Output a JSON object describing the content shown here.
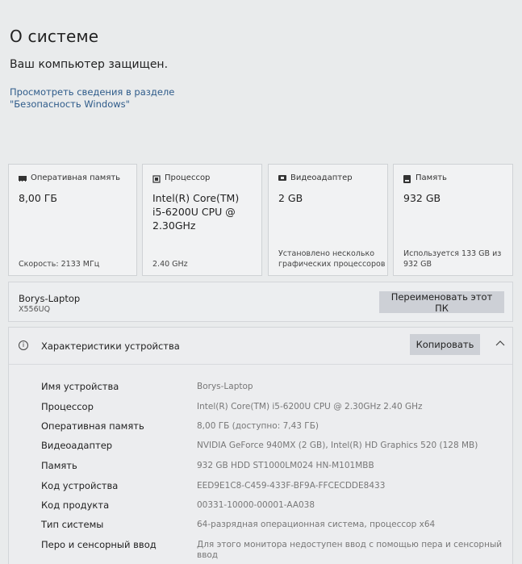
{
  "header": {
    "title": "О системе",
    "protected_text": "Ваш компьютер защищен.",
    "security_link": "Просмотреть сведения в разделе \"Безопасность Windows\""
  },
  "cards": [
    {
      "label": "Оперативная память",
      "icon": "ram-icon",
      "value": "8,00 ГБ",
      "foot": "Скорость: 2133 МГц"
    },
    {
      "label": "Процессор",
      "icon": "processor-icon",
      "value": "Intel(R) Core(TM) i5-6200U CPU @ 2.30GHz",
      "foot": "2.40 GHz"
    },
    {
      "label": "Видеоадаптер",
      "icon": "gpu-icon",
      "value": "2 GB",
      "foot": "Установлено несколько графических процессоров"
    },
    {
      "label": "Память",
      "icon": "storage-icon",
      "value": "932 GB",
      "foot": "Используется 133 GB из 932 GB"
    }
  ],
  "pc": {
    "name": "Borys-Laptop",
    "model": "X556UQ",
    "rename_label": "Переименовать этот ПК"
  },
  "specs": {
    "title": "Характеристики устройства",
    "copy_label": "Копировать",
    "rows": [
      {
        "label": "Имя устройства",
        "value": "Borys-Laptop"
      },
      {
        "label": "Процессор",
        "value": "Intel(R) Core(TM) i5-6200U CPU @ 2.30GHz   2.40 GHz"
      },
      {
        "label": "Оперативная память",
        "value": "8,00 ГБ (доступно: 7,43 ГБ)"
      },
      {
        "label": "Видеоадаптер",
        "value": "NVIDIA GeForce 940MX (2 GB), Intel(R) HD Graphics 520 (128 MB)"
      },
      {
        "label": "Память",
        "value": "932 GB HDD ST1000LM024 HN-M101MBB"
      },
      {
        "label": "Код устройства",
        "value": "EED9E1C8-C459-433F-BF9A-FFCECDDE8433"
      },
      {
        "label": "Код продукта",
        "value": "00331-10000-00001-AA038"
      },
      {
        "label": "Тип системы",
        "value": "64-разрядная операционная система, процессор x64"
      },
      {
        "label": "Перо и сенсорный ввод",
        "value": "Для этого монитора недоступен ввод с помощью пера и сенсорный ввод"
      }
    ]
  }
}
